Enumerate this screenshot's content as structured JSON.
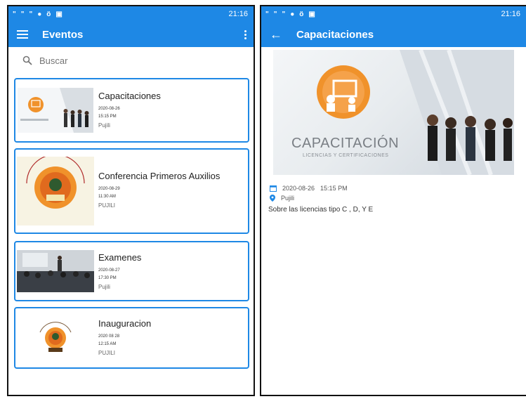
{
  "colors": {
    "primary": "#1e88e5",
    "orange": "#f0922b"
  },
  "left": {
    "status": {
      "time": "21:16",
      "icons": [
        "pinterest-icon",
        "pinterest-icon",
        "pinterest-icon",
        "app-icon",
        "android-icon",
        "photo-icon"
      ]
    },
    "appbar": {
      "title": "Eventos",
      "left_icon": "menu-icon",
      "right_icon": "more-vert-icon"
    },
    "search": {
      "placeholder": "Buscar"
    },
    "events": [
      {
        "title": "Capacitaciones",
        "date": "2020-08-26",
        "time": "15:15 PM",
        "place": "Pujili",
        "thumb": "capacitacion-image"
      },
      {
        "title": "Conferencia Primeros Auxilios",
        "date": "2020-08-29",
        "time": "11:30 AM",
        "place": "PUJILI",
        "thumb": "sindicato-logo",
        "logo_text_top": "SINDICATO DE CHOFERES PROFESIONALES DE PUJILI",
        "logo_text_bottom": "ESCUELA DE CAPACITACION"
      },
      {
        "title": "Examenes",
        "date": "2020-08-27",
        "time": "17:30 PM",
        "place": "Pujili",
        "thumb": "classroom-photo"
      },
      {
        "title": "Inauguracion",
        "date": "2020 08 28",
        "time": "12:15 AM",
        "place": "PUJILI",
        "thumb": "emblem-logo"
      }
    ]
  },
  "right": {
    "status": {
      "time": "21:16"
    },
    "appbar": {
      "title": "Capacitaciones",
      "left_icon": "back-arrow-icon"
    },
    "hero": {
      "label": "CAPACITACIÓN",
      "sublabel": "LICENCIAS Y CERTIFICACIONES"
    },
    "detail": {
      "date": "2020-08-26",
      "time": "15:15 PM",
      "place": "Pujili",
      "description": "Sobre las licencias tipo C , D, Y E"
    }
  }
}
